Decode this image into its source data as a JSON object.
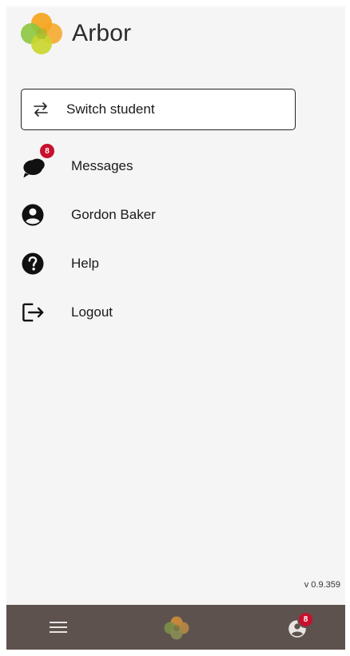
{
  "app": {
    "name": "Arbor",
    "version": "v 0.9.359"
  },
  "switch_student": {
    "label": "Switch student",
    "icon": "swap-arrows-icon"
  },
  "menu": {
    "messages": {
      "label": "Messages",
      "badge": "8",
      "icon": "chat-bubbles-icon"
    },
    "profile": {
      "label": "Gordon Baker",
      "icon": "user-circle-icon"
    },
    "help": {
      "label": "Help",
      "icon": "question-circle-icon"
    },
    "logout": {
      "label": "Logout",
      "icon": "logout-icon"
    }
  },
  "bottom_nav": {
    "menu_icon": "hamburger-icon",
    "home_icon": "arbor-logo-icon",
    "profile_icon": "user-circle-icon",
    "profile_badge": "8"
  },
  "colors": {
    "badge": "#c8102e",
    "bottom_bar": "#5e524e",
    "background": "#f5f5f5",
    "logo_orange": "#f5a623",
    "logo_green": "#8dc63f",
    "logo_yellow": "#d4d800"
  }
}
